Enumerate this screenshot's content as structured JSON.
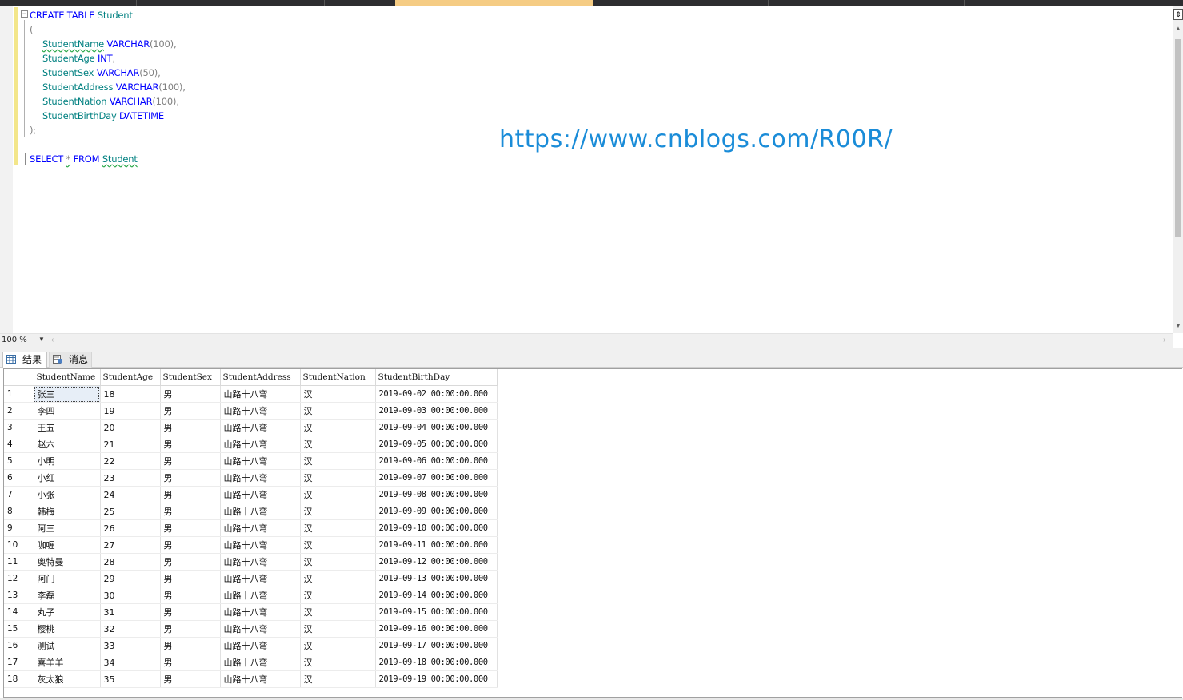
{
  "editor": {
    "lines": [
      [
        [
          "kw",
          "CREATE TABLE "
        ],
        [
          "id",
          "Student"
        ]
      ],
      [
        [
          "pn",
          "("
        ]
      ],
      [
        [
          "id",
          "StudentName",
          "squiggle"
        ],
        [
          "kw",
          " VARCHAR"
        ],
        [
          "pn",
          "(100),"
        ]
      ],
      [
        [
          "id",
          "StudentAge"
        ],
        [
          "kw",
          " INT"
        ],
        [
          "pn",
          ","
        ]
      ],
      [
        [
          "id",
          "StudentSex"
        ],
        [
          "kw",
          " VARCHAR"
        ],
        [
          "pn",
          "(50),"
        ]
      ],
      [
        [
          "id",
          "StudentAddress"
        ],
        [
          "kw",
          " VARCHAR"
        ],
        [
          "pn",
          "(100),"
        ]
      ],
      [
        [
          "id",
          "StudentNation"
        ],
        [
          "kw",
          " VARCHAR"
        ],
        [
          "pn",
          "(100),"
        ]
      ],
      [
        [
          "id",
          "StudentBirthDay"
        ],
        [
          "kw",
          " DATETIME"
        ]
      ],
      [
        [
          "pn",
          ");"
        ]
      ],
      [],
      [
        [
          "kw",
          "SELECT "
        ],
        [
          "pn",
          "*",
          "squiggle"
        ],
        [
          "kw",
          " FROM "
        ],
        [
          "id",
          "Student",
          "squiggle"
        ]
      ]
    ],
    "indent": [
      0,
      0,
      1,
      1,
      1,
      1,
      1,
      1,
      0,
      0,
      0
    ],
    "fold_symbol": "−"
  },
  "watermark": "https://www.cnblogs.com/R00R/",
  "zoom": {
    "value": "100 %"
  },
  "results_tabs": [
    {
      "label": "结果",
      "icon": "grid-icon"
    },
    {
      "label": "消息",
      "icon": "message-icon"
    }
  ],
  "grid": {
    "columns": [
      "StudentName",
      "StudentAge",
      "StudentSex",
      "StudentAddress",
      "StudentNation",
      "StudentBirthDay"
    ],
    "rows": [
      [
        "1",
        "张三",
        "18",
        "男",
        "山路十八弯",
        "汉",
        "2019-09-02 00:00:00.000"
      ],
      [
        "2",
        "李四",
        "19",
        "男",
        "山路十八弯",
        "汉",
        "2019-09-03 00:00:00.000"
      ],
      [
        "3",
        "王五",
        "20",
        "男",
        "山路十八弯",
        "汉",
        "2019-09-04 00:00:00.000"
      ],
      [
        "4",
        "赵六",
        "21",
        "男",
        "山路十八弯",
        "汉",
        "2019-09-05 00:00:00.000"
      ],
      [
        "5",
        "小明",
        "22",
        "男",
        "山路十八弯",
        "汉",
        "2019-09-06 00:00:00.000"
      ],
      [
        "6",
        "小红",
        "23",
        "男",
        "山路十八弯",
        "汉",
        "2019-09-07 00:00:00.000"
      ],
      [
        "7",
        "小张",
        "24",
        "男",
        "山路十八弯",
        "汉",
        "2019-09-08 00:00:00.000"
      ],
      [
        "8",
        "韩梅",
        "25",
        "男",
        "山路十八弯",
        "汉",
        "2019-09-09 00:00:00.000"
      ],
      [
        "9",
        "阿三",
        "26",
        "男",
        "山路十八弯",
        "汉",
        "2019-09-10 00:00:00.000"
      ],
      [
        "10",
        "咖喱",
        "27",
        "男",
        "山路十八弯",
        "汉",
        "2019-09-11 00:00:00.000"
      ],
      [
        "11",
        "奥特曼",
        "28",
        "男",
        "山路十八弯",
        "汉",
        "2019-09-12 00:00:00.000"
      ],
      [
        "12",
        "阿门",
        "29",
        "男",
        "山路十八弯",
        "汉",
        "2019-09-13 00:00:00.000"
      ],
      [
        "13",
        "李磊",
        "30",
        "男",
        "山路十八弯",
        "汉",
        "2019-09-14 00:00:00.000"
      ],
      [
        "14",
        "丸子",
        "31",
        "男",
        "山路十八弯",
        "汉",
        "2019-09-15 00:00:00.000"
      ],
      [
        "15",
        "樱桃",
        "32",
        "男",
        "山路十八弯",
        "汉",
        "2019-09-16 00:00:00.000"
      ],
      [
        "16",
        "测试",
        "33",
        "男",
        "山路十八弯",
        "汉",
        "2019-09-17 00:00:00.000"
      ],
      [
        "17",
        "喜羊羊",
        "34",
        "男",
        "山路十八弯",
        "汉",
        "2019-09-18 00:00:00.000"
      ],
      [
        "18",
        "灰太狼",
        "35",
        "男",
        "山路十八弯",
        "汉",
        "2019-09-19 00:00:00.000"
      ]
    ],
    "selected_cell": [
      0,
      1
    ]
  },
  "colors": {
    "keyword": "#0000ff",
    "identifier": "#008080",
    "punctuation": "#808080",
    "watermark": "#1a8cd8",
    "active_tab": "#f5cc84"
  }
}
